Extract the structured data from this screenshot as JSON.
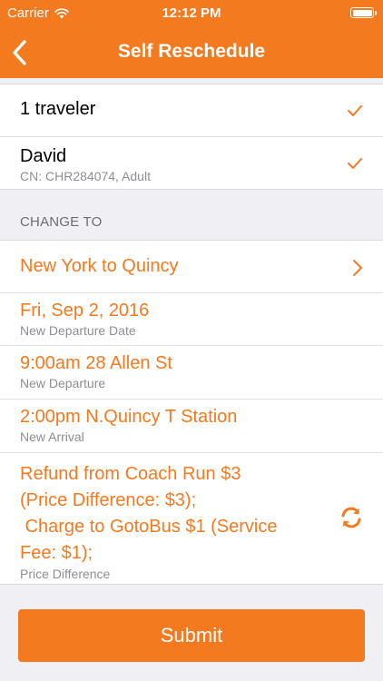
{
  "status_bar": {
    "carrier": "Carrier",
    "time": "12:12 PM"
  },
  "nav": {
    "title": "Self Reschedule"
  },
  "travelers": {
    "count_label": "1 traveler",
    "items": [
      {
        "name": "David",
        "details": "CN: CHR284074, Adult"
      }
    ]
  },
  "change_to": {
    "section_label": "CHANGE TO",
    "route": "New York to Quincy",
    "date": {
      "value": "Fri, Sep 2, 2016",
      "label": "New Departure Date"
    },
    "departure": {
      "value": "9:00am 28 Allen St",
      "label": "New Departure"
    },
    "arrival": {
      "value": "2:00pm N.Quincy T Station",
      "label": "New Arrival"
    },
    "price": {
      "lines": [
        "Refund from Coach Run $3",
        "(Price Difference: $3);",
        " Charge to GotoBus $1 (Service",
        "Fee: $1);"
      ],
      "label": "Price Difference"
    }
  },
  "actions": {
    "submit_label": "Submit"
  },
  "colors": {
    "accent": "#f47a20",
    "background": "#efeff4"
  }
}
